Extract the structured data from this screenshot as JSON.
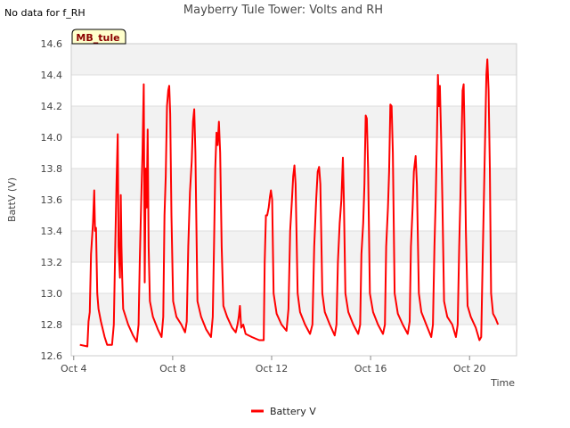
{
  "no_data_note": "No data for f_RH",
  "site_badge": "MB_tule",
  "chart_data": {
    "type": "line",
    "title": "Mayberry Tule Tower: Volts and RH",
    "xlabel": "Time",
    "ylabel": "BattV (V)",
    "x_range": [
      "Oct 4",
      "Oct 22"
    ],
    "x_unit": "days (Oct 4 = 0)",
    "ylim": [
      12.6,
      14.6
    ],
    "yticks": [
      "12.6",
      "12.8",
      "13.0",
      "13.2",
      "13.4",
      "13.6",
      "13.8",
      "14.0",
      "14.2",
      "14.4",
      "14.6"
    ],
    "xticks": [
      {
        "label": "Oct 4",
        "day": 0
      },
      {
        "label": "Oct 8",
        "day": 4
      },
      {
        "label": "Oct 12",
        "day": 8
      },
      {
        "label": "Oct 16",
        "day": 12
      },
      {
        "label": "Oct 20",
        "day": 16
      }
    ],
    "grid": true,
    "legend_position": "bottom-center",
    "series": [
      {
        "name": "Battery V",
        "color": "#ff0000",
        "points": [
          [
            0.25,
            12.67
          ],
          [
            0.55,
            12.66
          ],
          [
            0.6,
            12.82
          ],
          [
            0.65,
            12.88
          ],
          [
            0.7,
            13.25
          ],
          [
            0.78,
            13.45
          ],
          [
            0.83,
            13.66
          ],
          [
            0.86,
            13.4
          ],
          [
            0.9,
            13.42
          ],
          [
            0.95,
            13.0
          ],
          [
            1.0,
            12.9
          ],
          [
            1.1,
            12.82
          ],
          [
            1.25,
            12.72
          ],
          [
            1.35,
            12.67
          ],
          [
            1.55,
            12.67
          ],
          [
            1.62,
            12.8
          ],
          [
            1.68,
            13.3
          ],
          [
            1.73,
            13.7
          ],
          [
            1.78,
            14.02
          ],
          [
            1.81,
            13.3
          ],
          [
            1.84,
            13.2
          ],
          [
            1.87,
            13.1
          ],
          [
            1.9,
            13.63
          ],
          [
            1.93,
            13.3
          ],
          [
            1.96,
            13.1
          ],
          [
            2.0,
            12.9
          ],
          [
            2.2,
            12.8
          ],
          [
            2.4,
            12.73
          ],
          [
            2.55,
            12.69
          ],
          [
            2.62,
            12.8
          ],
          [
            2.67,
            13.2
          ],
          [
            2.73,
            13.6
          ],
          [
            2.78,
            13.9
          ],
          [
            2.83,
            14.34
          ],
          [
            2.87,
            13.07
          ],
          [
            2.91,
            13.8
          ],
          [
            2.95,
            13.55
          ],
          [
            2.99,
            14.05
          ],
          [
            3.03,
            13.3
          ],
          [
            3.08,
            12.95
          ],
          [
            3.2,
            12.85
          ],
          [
            3.4,
            12.77
          ],
          [
            3.55,
            12.72
          ],
          [
            3.62,
            12.85
          ],
          [
            3.67,
            13.5
          ],
          [
            3.72,
            13.75
          ],
          [
            3.77,
            14.2
          ],
          [
            3.82,
            14.3
          ],
          [
            3.86,
            14.33
          ],
          [
            3.9,
            14.15
          ],
          [
            3.95,
            13.5
          ],
          [
            4.02,
            12.95
          ],
          [
            4.15,
            12.85
          ],
          [
            4.35,
            12.8
          ],
          [
            4.5,
            12.75
          ],
          [
            4.57,
            12.82
          ],
          [
            4.63,
            13.3
          ],
          [
            4.7,
            13.65
          ],
          [
            4.77,
            13.85
          ],
          [
            4.82,
            14.1
          ],
          [
            4.87,
            14.18
          ],
          [
            4.92,
            13.9
          ],
          [
            5.0,
            12.95
          ],
          [
            5.15,
            12.85
          ],
          [
            5.35,
            12.77
          ],
          [
            5.55,
            12.72
          ],
          [
            5.62,
            12.85
          ],
          [
            5.67,
            13.3
          ],
          [
            5.72,
            13.8
          ],
          [
            5.77,
            14.03
          ],
          [
            5.82,
            13.95
          ],
          [
            5.87,
            14.1
          ],
          [
            5.92,
            13.9
          ],
          [
            5.98,
            13.3
          ],
          [
            6.05,
            12.92
          ],
          [
            6.2,
            12.85
          ],
          [
            6.4,
            12.78
          ],
          [
            6.55,
            12.75
          ],
          [
            6.62,
            12.8
          ],
          [
            6.67,
            12.85
          ],
          [
            6.72,
            12.92
          ],
          [
            6.77,
            12.78
          ],
          [
            6.85,
            12.8
          ],
          [
            6.95,
            12.74
          ],
          [
            7.2,
            12.72
          ],
          [
            7.5,
            12.7
          ],
          [
            7.68,
            12.7
          ],
          [
            7.72,
            13.2
          ],
          [
            7.77,
            13.5
          ],
          [
            7.82,
            13.5
          ],
          [
            7.88,
            13.55
          ],
          [
            7.93,
            13.62
          ],
          [
            7.97,
            13.66
          ],
          [
            8.02,
            13.6
          ],
          [
            8.08,
            13.0
          ],
          [
            8.2,
            12.87
          ],
          [
            8.4,
            12.8
          ],
          [
            8.6,
            12.76
          ],
          [
            8.68,
            12.9
          ],
          [
            8.75,
            13.4
          ],
          [
            8.82,
            13.6
          ],
          [
            8.87,
            13.75
          ],
          [
            8.92,
            13.82
          ],
          [
            8.97,
            13.7
          ],
          [
            9.05,
            13.0
          ],
          [
            9.15,
            12.88
          ],
          [
            9.35,
            12.8
          ],
          [
            9.55,
            12.74
          ],
          [
            9.65,
            12.8
          ],
          [
            9.72,
            13.3
          ],
          [
            9.8,
            13.6
          ],
          [
            9.86,
            13.78
          ],
          [
            9.92,
            13.81
          ],
          [
            9.97,
            13.7
          ],
          [
            10.05,
            13.0
          ],
          [
            10.15,
            12.88
          ],
          [
            10.35,
            12.8
          ],
          [
            10.55,
            12.73
          ],
          [
            10.62,
            12.8
          ],
          [
            10.68,
            13.2
          ],
          [
            10.75,
            13.45
          ],
          [
            10.82,
            13.6
          ],
          [
            10.88,
            13.87
          ],
          [
            10.92,
            13.6
          ],
          [
            10.98,
            13.0
          ],
          [
            11.1,
            12.88
          ],
          [
            11.3,
            12.8
          ],
          [
            11.5,
            12.74
          ],
          [
            11.58,
            12.8
          ],
          [
            11.63,
            13.25
          ],
          [
            11.7,
            13.45
          ],
          [
            11.75,
            13.7
          ],
          [
            11.8,
            14.14
          ],
          [
            11.85,
            14.12
          ],
          [
            11.9,
            13.8
          ],
          [
            11.97,
            13.0
          ],
          [
            12.1,
            12.88
          ],
          [
            12.3,
            12.8
          ],
          [
            12.5,
            12.74
          ],
          [
            12.58,
            12.8
          ],
          [
            12.63,
            13.3
          ],
          [
            12.7,
            13.55
          ],
          [
            12.75,
            13.78
          ],
          [
            12.8,
            14.21
          ],
          [
            12.85,
            14.2
          ],
          [
            12.9,
            13.9
          ],
          [
            12.97,
            13.0
          ],
          [
            13.1,
            12.87
          ],
          [
            13.3,
            12.8
          ],
          [
            13.5,
            12.74
          ],
          [
            13.58,
            12.82
          ],
          [
            13.63,
            13.3
          ],
          [
            13.7,
            13.55
          ],
          [
            13.75,
            13.78
          ],
          [
            13.82,
            13.88
          ],
          [
            13.87,
            13.7
          ],
          [
            13.95,
            13.0
          ],
          [
            14.05,
            12.88
          ],
          [
            14.25,
            12.8
          ],
          [
            14.45,
            12.72
          ],
          [
            14.52,
            12.8
          ],
          [
            14.58,
            13.3
          ],
          [
            14.63,
            13.6
          ],
          [
            14.68,
            14.0
          ],
          [
            14.72,
            14.4
          ],
          [
            14.76,
            14.2
          ],
          [
            14.8,
            14.33
          ],
          [
            14.85,
            14.0
          ],
          [
            14.9,
            13.6
          ],
          [
            14.97,
            12.95
          ],
          [
            15.1,
            12.85
          ],
          [
            15.3,
            12.8
          ],
          [
            15.45,
            12.72
          ],
          [
            15.52,
            12.8
          ],
          [
            15.58,
            13.3
          ],
          [
            15.63,
            13.6
          ],
          [
            15.68,
            14.0
          ],
          [
            15.72,
            14.3
          ],
          [
            15.76,
            14.34
          ],
          [
            15.8,
            14.0
          ],
          [
            15.85,
            13.4
          ],
          [
            15.92,
            12.92
          ],
          [
            16.05,
            12.85
          ],
          [
            16.25,
            12.78
          ],
          [
            16.4,
            12.7
          ],
          [
            16.47,
            12.72
          ],
          [
            16.53,
            13.2
          ],
          [
            16.58,
            13.6
          ],
          [
            16.63,
            14.0
          ],
          [
            16.68,
            14.4
          ],
          [
            16.72,
            14.5
          ],
          [
            16.77,
            14.3
          ],
          [
            16.82,
            13.8
          ],
          [
            16.87,
            13.0
          ],
          [
            16.95,
            12.87
          ],
          [
            17.05,
            12.84
          ],
          [
            17.15,
            12.8
          ]
        ]
      }
    ]
  }
}
